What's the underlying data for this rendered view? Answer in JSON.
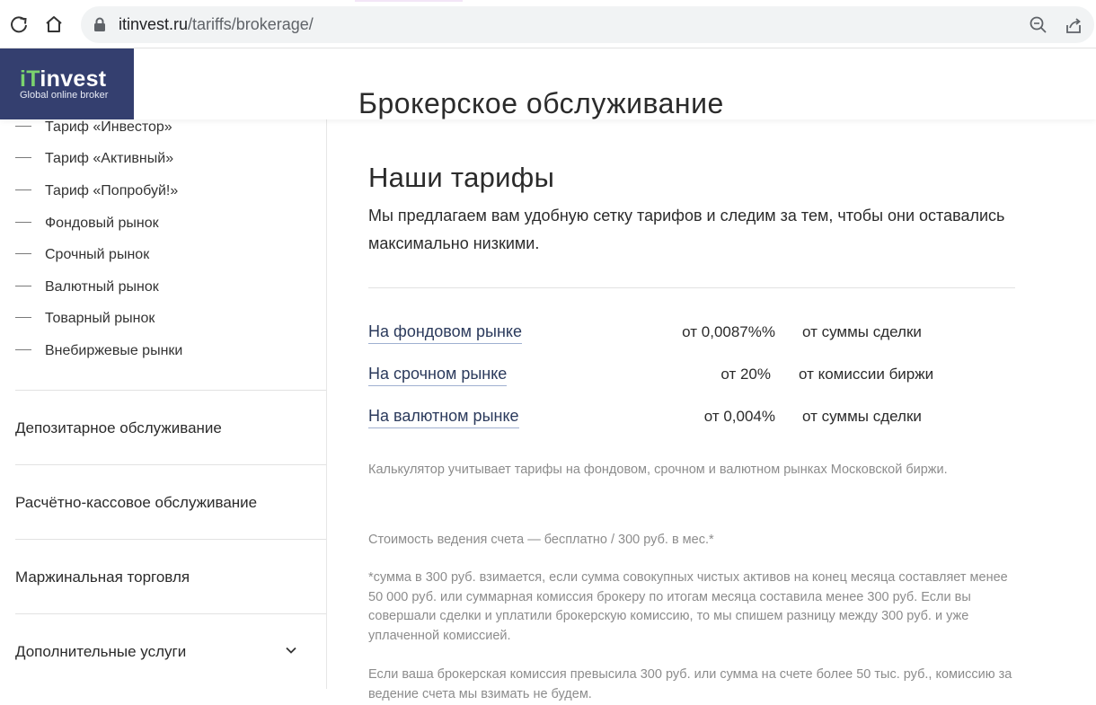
{
  "browser": {
    "url_domain": "itinvest.ru",
    "url_path": "/tariffs/brokerage/"
  },
  "header": {
    "logo_main_accent": "iT",
    "logo_main_rest": "invest",
    "logo_sub": "Global online broker",
    "title": "Брокерское обслуживание"
  },
  "sidebar": {
    "sub_items": [
      {
        "label": "Тариф «Инвестор»"
      },
      {
        "label": "Тариф «Активный»"
      },
      {
        "label": "Тариф «Попробуй!»"
      },
      {
        "label": "Фондовый рынок"
      },
      {
        "label": "Срочный рынок"
      },
      {
        "label": "Валютный рынок"
      },
      {
        "label": "Товарный рынок"
      },
      {
        "label": "Внебиржевые рынки"
      }
    ],
    "sections": [
      {
        "label": "Депозитарное обслуживание"
      },
      {
        "label": "Расчётно-кассовое обслуживание"
      },
      {
        "label": "Маржинальная торговля"
      },
      {
        "label": "Дополнительные услуги"
      }
    ]
  },
  "main": {
    "title": "Наши тарифы",
    "intro": "Мы предлагаем вам удобную сетку тарифов и следим за тем, чтобы они оставались максимально низкими.",
    "rates": [
      {
        "market": "На фондовом рынке",
        "value": "от 0,0087%%",
        "desc": "от суммы сделки"
      },
      {
        "market": "На срочном рынке",
        "value": "от 20%",
        "desc": "от комиссии биржи"
      },
      {
        "market": "На валютном рынке",
        "value": "от 0,004%",
        "desc": "от суммы сделки"
      }
    ],
    "calculator_note": "Калькулятор учитывает тарифы на фондовом, срочном и валютном рынках Московской биржи.",
    "account_fee": "Стоимость ведения счета — бесплатно / 300 руб. в мес.*",
    "footnote": "*сумма в 300 руб. взимается, если сумма совокупных чистых активов на конец месяца составляет менее 50 000 руб. или суммарная комиссия брокеру по итогам месяца составила менее 300 руб. Если вы совершали сделки и уплатили брокерскую комиссию, то мы спишем разницу между 300 руб. и уже уплаченной комиссией.",
    "waiver": "Если ваша брокерская комиссия превысила 300 руб. или сумма на счете более 50 тыс. руб., комиссию за ведение счета мы взимать не будем."
  },
  "colors": {
    "logo_bg": "#343f6f",
    "logo_accent": "#7bd36e",
    "link": "#2b3a5c"
  }
}
